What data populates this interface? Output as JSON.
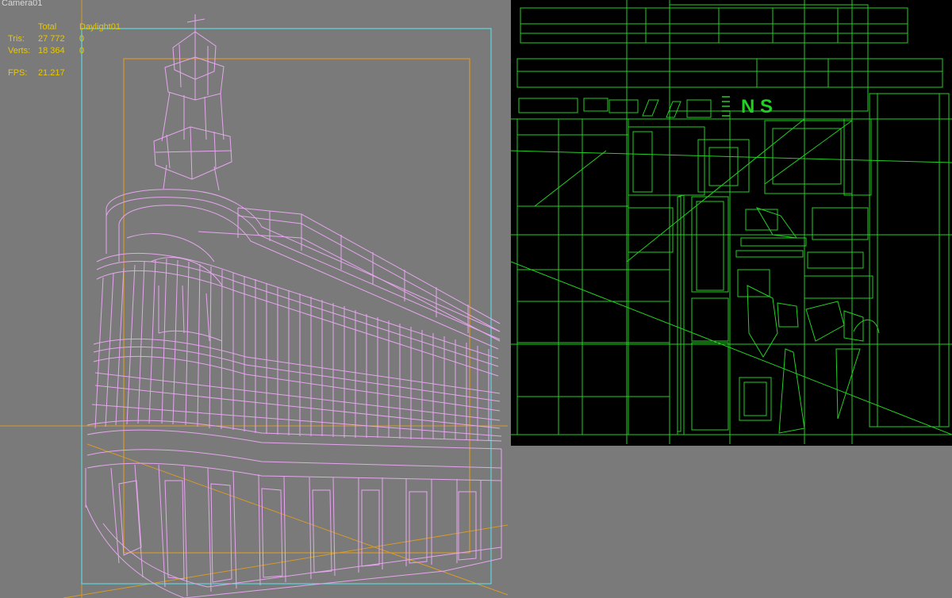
{
  "viewport": {
    "label": "Camera01"
  },
  "stats": {
    "header": {
      "col1": "Total",
      "col2": "Daylight01"
    },
    "rows": [
      {
        "label": "Tris:",
        "total": "27 772",
        "selected": "0"
      },
      {
        "label": "Verts:",
        "total": "18 364",
        "selected": "0"
      }
    ],
    "fps_label": "FPS:",
    "fps_value": "21.217"
  },
  "colors": {
    "viewport_bg": "#7a7a7a",
    "wireframe": "#e6a6ee",
    "safe_frame_outer": "#5fd6de",
    "safe_frame_inner": "#d79a2a",
    "uv_background": "#000000",
    "uv_lines": "#22d022",
    "stats_text": "#e8c800"
  },
  "uv_panel": {
    "letters": "N S"
  }
}
